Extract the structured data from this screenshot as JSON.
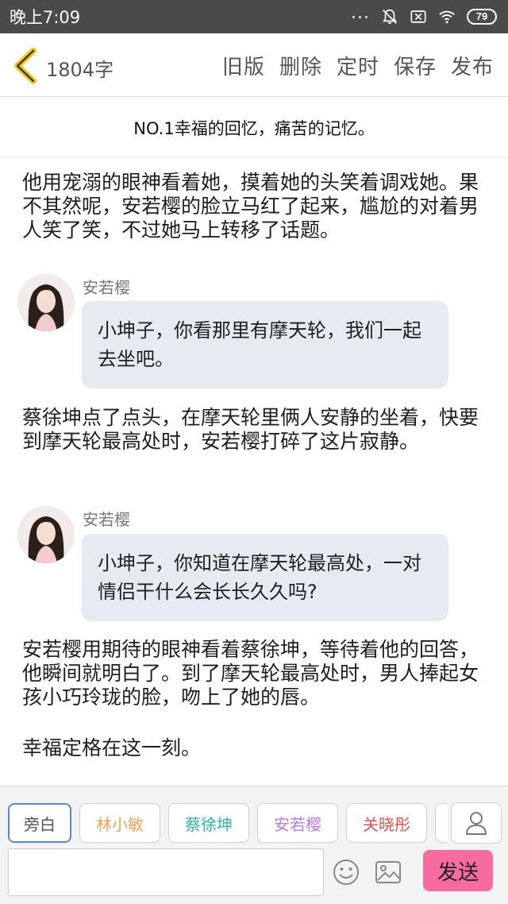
{
  "status_bar": {
    "time": "晚上7:09",
    "dots": "...",
    "battery": "79",
    "icons": [
      "mute-icon",
      "close-box-icon",
      "wifi-icon",
      "battery-icon"
    ]
  },
  "top_bar": {
    "word_count": "1804字",
    "actions": [
      "旧版",
      "删除",
      "定时",
      "保存",
      "发布"
    ]
  },
  "chapter_title": "NO.1幸福的回忆，痛苦的记忆。",
  "content": {
    "para1": "他用宠溺的眼神看着她，摸着她的头笑着调戏她。果不其然呢，安若樱的脸立马红了起来，尴尬的对着男人笑了笑，不过她马上转移了话题。",
    "message1": {
      "name": "安若樱",
      "text": "小坤子，你看那里有摩天轮，我们一起去坐吧。"
    },
    "para2": "蔡徐坤点了点头，在摩天轮里俩人安静的坐着，快要到摩天轮最高处时，安若樱打碎了这片寂静。",
    "message2": {
      "name": "安若樱",
      "text": "小坤子，你知道在摩天轮最高处，一对情侣干什么会长长久久吗?"
    },
    "para3": "安若樱用期待的眼神看着蔡徐坤，等待着他的回答，他瞬间就明白了。到了摩天轮最高处时，男人捧起女孩小巧玲珑的脸，吻上了她的唇。",
    "para4": "幸福定格在这一刻。"
  },
  "bottom": {
    "characters": [
      {
        "label": "旁白",
        "color": "#555555"
      },
      {
        "label": "林小敏",
        "color": "#f0a35a"
      },
      {
        "label": "蔡徐坤",
        "color": "#2fb6a0"
      },
      {
        "label": "安若樱",
        "color": "#b57be0"
      },
      {
        "label": "关晓彤",
        "color": "#e0504e"
      }
    ],
    "input_value": "",
    "send_label": "发送"
  },
  "colors": {
    "status_bar": "#4a4a4a",
    "bubble": "#e6eaf1",
    "send_button": "#f76c9e",
    "back_arrow": "#f5c518",
    "selected_chip_border": "#5b86d6"
  }
}
